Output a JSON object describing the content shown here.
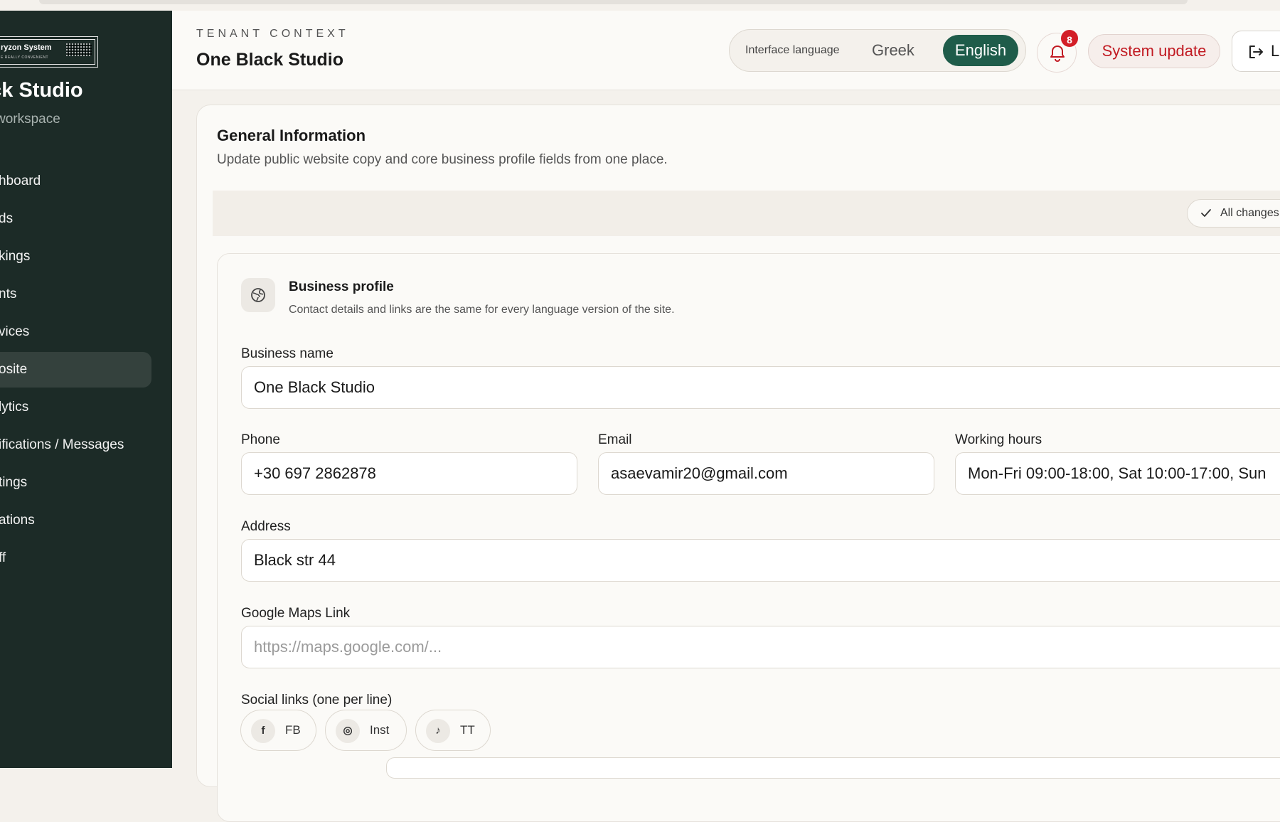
{
  "sidebar": {
    "logo_text": "ryzon System",
    "logo_tagline": "E REALLY CONVENIENT",
    "workspace_name": "ack Studio",
    "workspace_sub": "workspace",
    "items": [
      {
        "label": "hboard"
      },
      {
        "label": "ds"
      },
      {
        "label": "kings"
      },
      {
        "label": "nts"
      },
      {
        "label": "vices"
      },
      {
        "label": "osite",
        "active": true
      },
      {
        "label": "lytics"
      },
      {
        "label": "ifications / Messages"
      },
      {
        "label": "tings"
      },
      {
        "label": "ations"
      },
      {
        "label": "ff"
      }
    ]
  },
  "header": {
    "tenant_label": "TENANT CONTEXT",
    "tenant_name": "One Black Studio",
    "language_label": "Interface language",
    "lang_greek": "Greek",
    "lang_english": "English",
    "notification_count": "8",
    "system_update": "System update",
    "logout_label": "L"
  },
  "general": {
    "title": "General Information",
    "description": "Update public website copy and core business profile fields from one place.",
    "save_status": "All changes s"
  },
  "profile": {
    "title": "Business profile",
    "description": "Contact details and links are the same for every language version of the site.",
    "business_name_label": "Business name",
    "business_name_value": "One Black Studio",
    "phone_label": "Phone",
    "phone_value": "+30 697 2862878",
    "email_label": "Email",
    "email_value": "asaevamir20@gmail.com",
    "hours_label": "Working hours",
    "hours_value": "Mon-Fri 09:00-18:00, Sat 10:00-17:00, Sun",
    "address_label": "Address",
    "address_value": "Black str 44",
    "maps_label": "Google Maps Link",
    "maps_placeholder": "https://maps.google.com/...",
    "social_label": "Social links (one per line)",
    "social": [
      {
        "icon": "facebook-icon",
        "glyph": "f",
        "label": "FB"
      },
      {
        "icon": "instagram-icon",
        "glyph": "◎",
        "label": "Inst"
      },
      {
        "icon": "tiktok-icon",
        "glyph": "♪",
        "label": "TT"
      }
    ]
  },
  "colors": {
    "sidebar_bg": "#1c2b27",
    "accent_green": "#1f5c4a",
    "alert_red": "#d31e27"
  }
}
